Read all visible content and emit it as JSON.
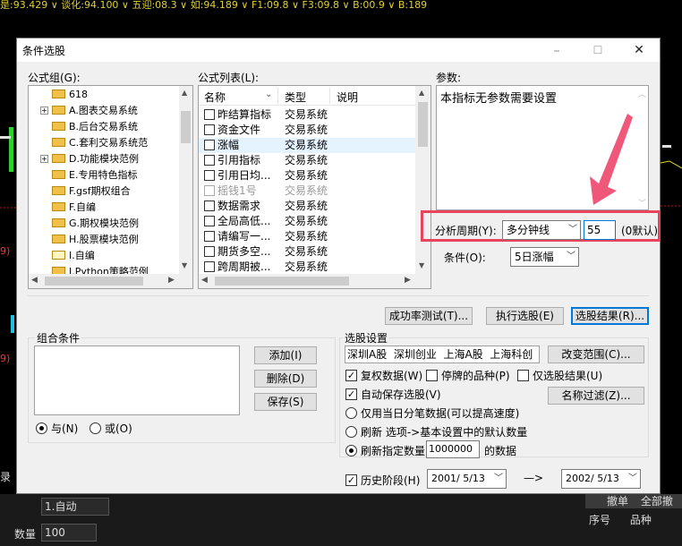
{
  "dialog": {
    "title": "条件选股",
    "min_btn": "–",
    "max_btn": "☐",
    "close_btn": "✕"
  },
  "formula_group": {
    "label": "公式组(G):",
    "items": [
      {
        "label": "618",
        "expander": ""
      },
      {
        "label": "A.图表交易系统",
        "expander": "+"
      },
      {
        "label": "B.后台交易系统",
        "expander": ""
      },
      {
        "label": "C.套利交易系统范",
        "expander": ""
      },
      {
        "label": "D.功能模块范例",
        "expander": "+"
      },
      {
        "label": "E.专用特色指标",
        "expander": ""
      },
      {
        "label": "F.gsf期权组合",
        "expander": ""
      },
      {
        "label": "F.自编",
        "expander": ""
      },
      {
        "label": "G.期权模块范例",
        "expander": ""
      },
      {
        "label": "H.股票模块范例",
        "expander": ""
      },
      {
        "label": "I.自编",
        "expander": ""
      },
      {
        "label": "I.Python策略范例",
        "expander": ""
      }
    ]
  },
  "formula_list": {
    "label": "公式列表(L):",
    "headers": {
      "name": "名称",
      "type": "类型",
      "desc": "说明"
    },
    "rows": [
      {
        "name": "昨结算指标",
        "type": "交易系统",
        "selected": false,
        "gray": false
      },
      {
        "name": "资金文件",
        "type": "交易系统",
        "selected": false,
        "gray": false
      },
      {
        "name": "涨幅",
        "type": "交易系统",
        "selected": true,
        "gray": false
      },
      {
        "name": "引用指标",
        "type": "交易系统",
        "selected": false,
        "gray": false
      },
      {
        "name": "引用日均...",
        "type": "交易系统",
        "selected": false,
        "gray": false
      },
      {
        "name": "摇钱1号",
        "type": "交易系统",
        "selected": false,
        "gray": true
      },
      {
        "name": "数据需求",
        "type": "交易系统",
        "selected": false,
        "gray": false
      },
      {
        "name": "全局高低...",
        "type": "交易系统",
        "selected": false,
        "gray": false
      },
      {
        "name": "请编写一...",
        "type": "交易系统",
        "selected": false,
        "gray": false
      },
      {
        "name": "期货多空...",
        "type": "交易系统",
        "selected": false,
        "gray": false
      },
      {
        "name": "跨周期被...",
        "type": "交易系统",
        "selected": false,
        "gray": false
      }
    ]
  },
  "params": {
    "label": "参数:",
    "text": "本指标无参数需要设置"
  },
  "period": {
    "label": "分析周期(Y):",
    "value": "多分钟线",
    "minutes": "55",
    "default_note": "(0默认)"
  },
  "condition": {
    "label": "条件(O):",
    "value": "5日涨幅"
  },
  "buttons": {
    "success_test": "成功率测试(T)...",
    "run_select": "执行选股(E)",
    "select_result": "选股结果(R)..."
  },
  "combo_conditions": {
    "label": "组合条件",
    "add": "添加(I)",
    "delete": "删除(D)",
    "save": "保存(S)",
    "and_label": "与(N)",
    "or_label": "或(O)"
  },
  "stock_settings": {
    "label": "选股设置",
    "markets": "深圳A股  深圳创业  上海A股  上海科创",
    "change_range": "改变范围(C)...",
    "name_filter": "名称过滤(Z)...",
    "restore_data": "复权数据(W)",
    "suspended": "停牌的品种(P)",
    "select_result": "仅选股结果(U)",
    "auto_save": "自动保存选股(V)",
    "only_tick": "仅用当日分笔数据(可以提高速度)",
    "refresh_default": "刷新 选项->基本设置中的默认数量",
    "refresh_count": "刷新指定数量",
    "count_value": "1000000",
    "count_suffix": "的数据",
    "history": "历史阶段(H)",
    "date_from": "2001/ 5/13",
    "arrow": "—>",
    "date_to": "2002/ 5/13"
  },
  "background": {
    "ticker": "是:93.429 ∨ 谈化:94.100 ∨ 五迎:08.3 ∨ 如:94.189 ∨ F1:09.8 ∨ F3:09.8 ∨ B:00.9 ∨ B:189",
    "bottom_auto": "1.自动",
    "bottom_qty_label": "数量",
    "bottom_qty": "100",
    "cancel": "撤单",
    "all_cancel": "全部撤",
    "col_no": "序号",
    "col_name": "品种",
    "left_mark": "录"
  },
  "colors": {
    "highlight": "#e8455c",
    "arrow": "#f0587a",
    "selection": "#e5f3ff"
  }
}
